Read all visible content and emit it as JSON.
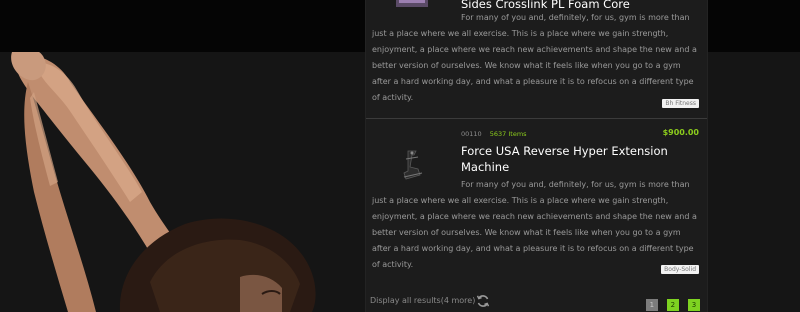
{
  "results": [
    {
      "title": "Sides Crosslink PL Foam Core",
      "description": "For many of you and, definitely, for us, gym is more than just a place where we all exercise. This is a place where we gain strength, enjoyment, a place where we reach new achievements and shape the new and a better version of ourselves. We know what it feels like when you go to a gym after a hard working day, and what a pleasure it is to refocus on a different type of activity.",
      "tag": "Bh Fitness",
      "thumbnail_icon": "product-image"
    },
    {
      "code": "00110",
      "stock": "5637 Items",
      "price": "$900.00",
      "title": "Force USA Reverse Hyper Extension Machine",
      "description": "For many of you and, definitely, for us, gym is more than just a place where we all exercise. This is a place where we gain strength, enjoyment, a place where we reach new achievements and shape the new and a better version of ourselves. We know what it feels like when you go to a gym after a hard working day, and what a pleasure it is to refocus on a different type of activity.",
      "tag": "Body-Solid",
      "thumbnail_icon": "gym-machine-image"
    }
  ],
  "footer": {
    "display_all": "Display all results(4 more)",
    "refresh_icon": "refresh-icon",
    "pages": [
      {
        "label": "1",
        "current": true
      },
      {
        "label": "2",
        "current": false
      },
      {
        "label": "3",
        "current": false
      }
    ]
  },
  "colors": {
    "accent": "#8ccc1c",
    "page_link": "#7ed321",
    "panel_bg": "#1c1c1c",
    "page_bg": "#141414"
  }
}
